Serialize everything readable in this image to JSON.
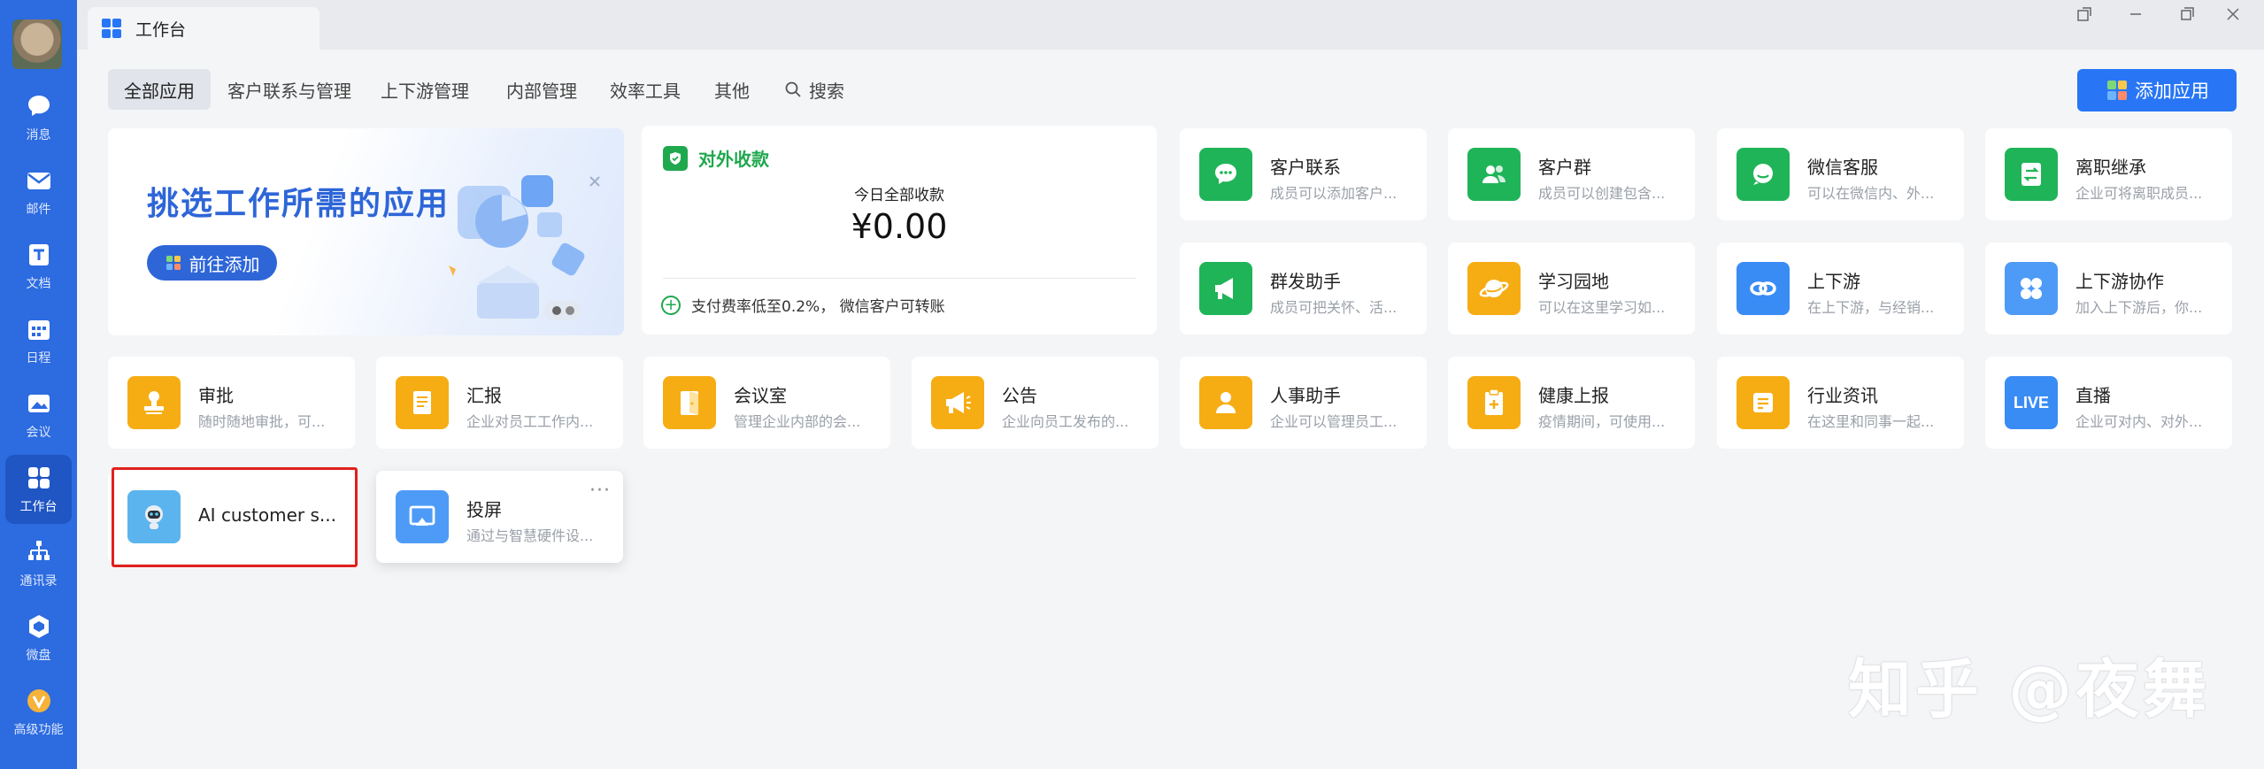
{
  "sidebar": {
    "items": [
      {
        "label": "消息",
        "icon": "chat-icon"
      },
      {
        "label": "邮件",
        "icon": "mail-icon"
      },
      {
        "label": "文档",
        "icon": "document-icon"
      },
      {
        "label": "日程",
        "icon": "calendar-icon"
      },
      {
        "label": "会议",
        "icon": "meeting-icon"
      },
      {
        "label": "工作台",
        "icon": "workbench-icon",
        "active": true
      },
      {
        "label": "通讯录",
        "icon": "contacts-icon"
      },
      {
        "label": "微盘",
        "icon": "drive-icon"
      },
      {
        "label": "高级功能",
        "icon": "advanced-icon"
      }
    ]
  },
  "window": {
    "tab_title": "工作台"
  },
  "categories": {
    "tabs": [
      "全部应用",
      "客户联系与管理",
      "上下游管理",
      "内部管理",
      "效率工具",
      "其他"
    ],
    "search_label": "搜索",
    "add_app_label": "添加应用"
  },
  "banner": {
    "title": "挑选工作所需的应用",
    "button_label": "前往添加"
  },
  "payment": {
    "title": "对外收款",
    "today_label": "今日全部收款",
    "amount": "¥0.00",
    "footer": "支付费率低至0.2%， 微信客户可转账"
  },
  "apps": {
    "customer_contact": {
      "name": "客户联系",
      "desc": "成员可以添加客户..."
    },
    "customer_group": {
      "name": "客户群",
      "desc": "成员可以创建包含..."
    },
    "wechat_service": {
      "name": "微信客服",
      "desc": "可以在微信内、外..."
    },
    "resign_inherit": {
      "name": "离职继承",
      "desc": "企业可将离职成员..."
    },
    "mass_send": {
      "name": "群发助手",
      "desc": "成员可把关怀、活..."
    },
    "learning": {
      "name": "学习园地",
      "desc": "可以在这里学习如..."
    },
    "upstream": {
      "name": "上下游",
      "desc": "在上下游，与经销..."
    },
    "upstream_collab": {
      "name": "上下游协作",
      "desc": "加入上下游后，你..."
    },
    "approval": {
      "name": "审批",
      "desc": "随时随地审批，可..."
    },
    "report": {
      "name": "汇报",
      "desc": "企业对员工工作内..."
    },
    "meeting_room": {
      "name": "会议室",
      "desc": "管理企业内部的会..."
    },
    "announcement": {
      "name": "公告",
      "desc": "企业向员工发布的..."
    },
    "hr_assistant": {
      "name": "人事助手",
      "desc": "企业可以管理员工..."
    },
    "health_report": {
      "name": "健康上报",
      "desc": "疫情期间，可使用..."
    },
    "industry_news": {
      "name": "行业资讯",
      "desc": "在这里和同事一起..."
    },
    "live": {
      "name": "直播",
      "desc": "企业可对内、对外...",
      "icon_text": "LIVE"
    },
    "ai_service": {
      "name": "AI  customer s..."
    },
    "screen_cast": {
      "name": "投屏",
      "desc": "通过与智慧硬件设...",
      "more": "···"
    }
  },
  "watermark": "知乎 @夜舞",
  "colors": {
    "sidebar": "#2c6be0",
    "primary": "#2876f5",
    "green": "#1fb458",
    "orange": "#f6ad14",
    "highlight": "#e0201d"
  }
}
